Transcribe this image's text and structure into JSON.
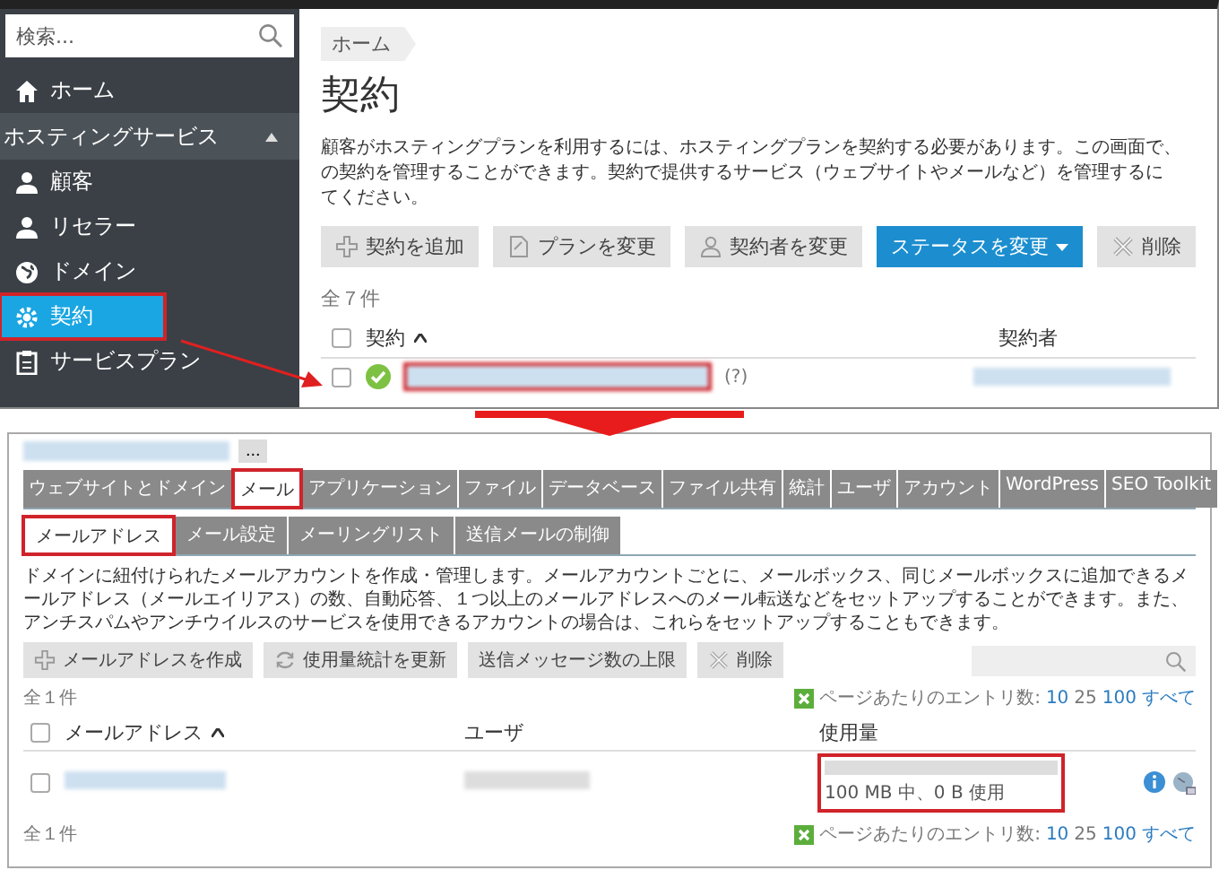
{
  "top": {
    "search": {
      "placeholder": "検索..."
    },
    "sidebar": {
      "items": [
        {
          "label": "ホーム",
          "kind": "link",
          "selected": false,
          "annotated": false
        },
        {
          "label": "ホスティングサービス",
          "kind": "section",
          "expanded": true
        },
        {
          "label": "顧客",
          "kind": "link",
          "selected": false,
          "annotated": false
        },
        {
          "label": "リセラー",
          "kind": "link",
          "selected": false,
          "annotated": false
        },
        {
          "label": "ドメイン",
          "kind": "link",
          "selected": false,
          "annotated": false
        },
        {
          "label": "契約",
          "kind": "link",
          "selected": true,
          "annotated": true
        },
        {
          "label": "サービスプラン",
          "kind": "link",
          "selected": false,
          "annotated": false
        }
      ]
    },
    "breadcrumb": "ホーム",
    "title": "契約",
    "description": [
      "顧客がホスティングプランを利用するには、ホスティングプランを契約する必要があります。この画面で、",
      "の契約を管理することができます。契約で提供するサービス（ウェブサイトやメールなど）を管理するに",
      "てください。"
    ],
    "buttons": [
      {
        "label": "契約を追加",
        "kind": "default"
      },
      {
        "label": "プランを変更",
        "kind": "default"
      },
      {
        "label": "契約者を変更",
        "kind": "default"
      },
      {
        "label": "ステータスを変更",
        "kind": "primary"
      },
      {
        "label": "削除",
        "kind": "default"
      }
    ],
    "count": "全７件",
    "table": {
      "columns": [
        {
          "label": "契約",
          "sorted": true
        },
        {
          "label": "契約者",
          "sorted": false
        }
      ],
      "header_checked": false,
      "rows": [
        {
          "checked": false,
          "active": true,
          "note": "(?)",
          "annotated": true
        }
      ]
    }
  },
  "bottom": {
    "more": "...",
    "tabs": [
      {
        "label": "ウェブサイトとドメイン",
        "selected": false,
        "annotated": false
      },
      {
        "label": "メール",
        "selected": true,
        "annotated": true
      },
      {
        "label": "アプリケーション",
        "selected": false,
        "annotated": false
      },
      {
        "label": "ファイル",
        "selected": false,
        "annotated": false
      },
      {
        "label": "データベース",
        "selected": false,
        "annotated": false
      },
      {
        "label": "ファイル共有",
        "selected": false,
        "annotated": false
      },
      {
        "label": "統計",
        "selected": false,
        "annotated": false
      },
      {
        "label": "ユーザ",
        "selected": false,
        "annotated": false
      },
      {
        "label": "アカウント",
        "selected": false,
        "annotated": false
      },
      {
        "label": "WordPress",
        "selected": false,
        "annotated": false
      },
      {
        "label": "SEO Toolkit",
        "selected": false,
        "annotated": false
      }
    ],
    "subtabs": [
      {
        "label": "メールアドレス",
        "selected": true,
        "annotated": true
      },
      {
        "label": "メール設定",
        "selected": false,
        "annotated": false
      },
      {
        "label": "メーリングリスト",
        "selected": false,
        "annotated": false
      },
      {
        "label": "送信メールの制御",
        "selected": false,
        "annotated": false
      }
    ],
    "description": "ドメインに紐付けられたメールアカウントを作成・管理します。メールアカウントごとに、メールボックス、同じメールボックスに追加できるメールアドレス（メールエイリアス）の数、自動応答、１つ以上のメールアドレスへのメール転送などをセットアップすることができます。また、アンチスパムやアンチウイルスのサービスを使用できるアカウントの場合は、これらをセットアップすることもできます。",
    "buttons": [
      {
        "label": "メールアドレスを作成"
      },
      {
        "label": "使用量統計を更新"
      },
      {
        "label": "送信メッセージ数の上限"
      },
      {
        "label": "削除"
      }
    ],
    "count": "全１件",
    "per_page": {
      "label": "ページあたりのエントリ数:",
      "options": [
        {
          "label": "10",
          "selected": false
        },
        {
          "label": "25",
          "selected": true
        },
        {
          "label": "100",
          "selected": false
        },
        {
          "label": "すべて",
          "selected": false
        }
      ]
    },
    "table": {
      "columns": [
        {
          "label": "メールアドレス",
          "sorted": true
        },
        {
          "label": "ユーザ",
          "sorted": false
        },
        {
          "label": "使用量",
          "sorted": false
        }
      ],
      "header_checked": false,
      "rows": [
        {
          "checked": false,
          "usage": {
            "level": 0,
            "text": "100 MB 中、0 B 使用",
            "annotated": true
          }
        }
      ]
    },
    "footer_count": "全１件",
    "footer_per_page": {
      "label": "ページあたりのエントリ数:",
      "options": [
        {
          "label": "10",
          "selected": false
        },
        {
          "label": "25",
          "selected": true
        },
        {
          "label": "100",
          "selected": false
        },
        {
          "label": "すべて",
          "selected": false
        }
      ]
    }
  }
}
